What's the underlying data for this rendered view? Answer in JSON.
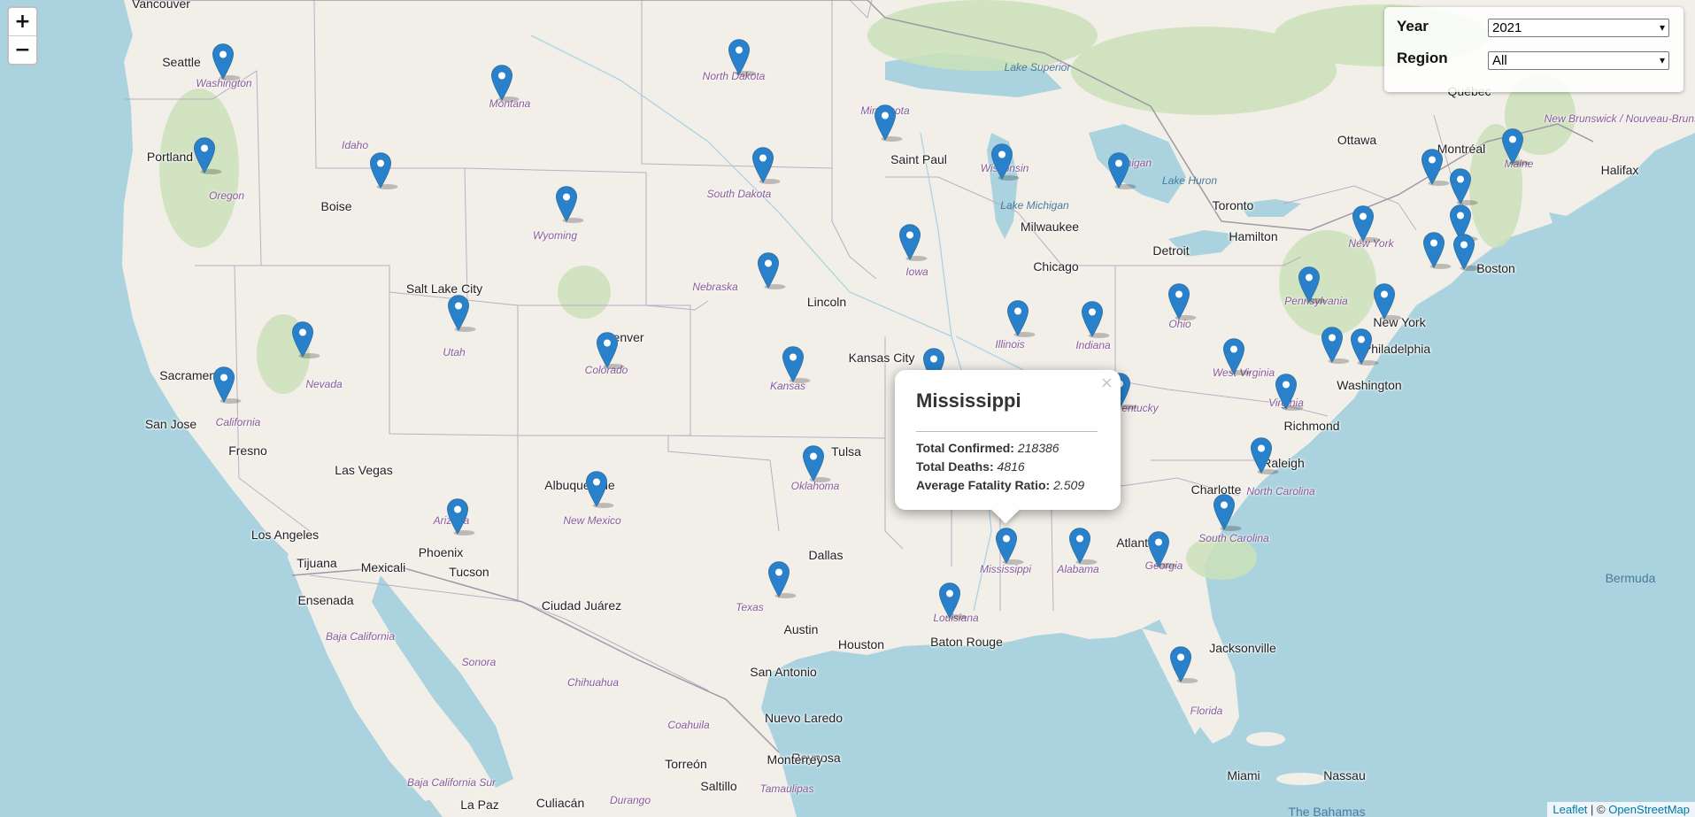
{
  "zoom": {
    "in": "+",
    "out": "−"
  },
  "controls": {
    "year_label": "Year",
    "year_value": "2021",
    "region_label": "Region",
    "region_value": "All",
    "chevron": "▾"
  },
  "popup": {
    "title": "Mississippi",
    "close": "×",
    "rows": [
      {
        "label": "Total Confirmed:",
        "value": "218386"
      },
      {
        "label": "Total Deaths:",
        "value": "4816"
      },
      {
        "label": "Average Fatality Ratio:",
        "value": "2.509"
      }
    ]
  },
  "attribution": {
    "leaflet": "Leaflet",
    "sep": " | © ",
    "osm": "OpenStreetMap"
  },
  "colors": {
    "marker": "#2a81cb",
    "marker_dark": "#3274a3",
    "water": "#aad3df",
    "land": "#f2efe9"
  },
  "markers": [
    "Washington",
    "Montana",
    "North Dakota",
    "Minnesota",
    "Oregon",
    "Idaho",
    "South Dakota",
    "Wisconsin",
    "Michigan",
    "Maine",
    "Vermont",
    "New Hampshire",
    "Wyoming",
    "New York",
    "Massachusetts",
    "Connecticut",
    "Rhode Island",
    "Iowa",
    "Nebraska",
    "Pennsylvania",
    "Utah",
    "Illinois",
    "Indiana",
    "Ohio",
    "New Jersey",
    "Nevada",
    "Colorado",
    "California",
    "Kansas",
    "Missouri",
    "West Virginia",
    "Maryland",
    "Delaware",
    "Kentucky",
    "Virginia",
    "Oklahoma",
    "North Carolina",
    "New Mexico",
    "Arizona",
    "South Carolina",
    "Alabama",
    "Georgia",
    "Mississippi",
    "Texas",
    "Louisiana",
    "Florida"
  ],
  "labels": {
    "cities": [
      "Vancouver",
      "Seattle",
      "Portland",
      "Boise",
      "Salt Lake City",
      "Sacramento",
      "San Jose",
      "Fresno",
      "Las Vegas",
      "Los Angeles",
      "Tijuana",
      "Mexicali",
      "Phoenix",
      "Tucson",
      "Ensenada",
      "Albuquerque",
      "Ciudad Juárez",
      "Denver",
      "Lincoln",
      "Kansas City",
      "Tulsa",
      "Dallas",
      "Austin",
      "Houston",
      "San Antonio",
      "Nuevo Laredo",
      "Reynosa",
      "Monterrey",
      "Torreón",
      "Saltillo",
      "Culiacán",
      "La Paz",
      "Baton Rouge",
      "Saint Paul",
      "Milwaukee",
      "Chicago",
      "Detroit",
      "Toronto",
      "Hamilton",
      "Ottawa",
      "Montréal",
      "Québec",
      "Halifax",
      "Boston",
      "New York",
      "Philadelphia",
      "Washington",
      "Richmond",
      "Raleigh",
      "Charlotte",
      "Atlanta",
      "Jacksonville",
      "Miami",
      "Nassau",
      "Bermuda",
      "The Bahamas"
    ],
    "states": [
      "Washington",
      "Oregon",
      "Idaho",
      "Montana",
      "North Dakota",
      "South Dakota",
      "Wyoming",
      "Nevada",
      "Utah",
      "Colorado",
      "California",
      "Arizona",
      "New Mexico",
      "Nebraska",
      "Kansas",
      "Oklahoma",
      "Texas",
      "Minnesota",
      "Iowa",
      "Wisconsin",
      "Michigan",
      "Illinois",
      "Indiana",
      "Ohio",
      "Kentucky",
      "Missouri",
      "Louisiana",
      "Mississippi",
      "Alabama",
      "Georgia",
      "Florida",
      "North Carolina",
      "South Carolina",
      "Virginia",
      "West Virginia",
      "Pennsylvania",
      "New York",
      "Maine",
      "Baja California",
      "Baja California Sur",
      "Sonora",
      "Chihuahua",
      "Coahuila",
      "Durango",
      "Tamaulipas",
      "New Brunswick / Nouveau-Brunswick",
      "Lake Superior",
      "Lake Michigan",
      "Lake Huron"
    ]
  }
}
